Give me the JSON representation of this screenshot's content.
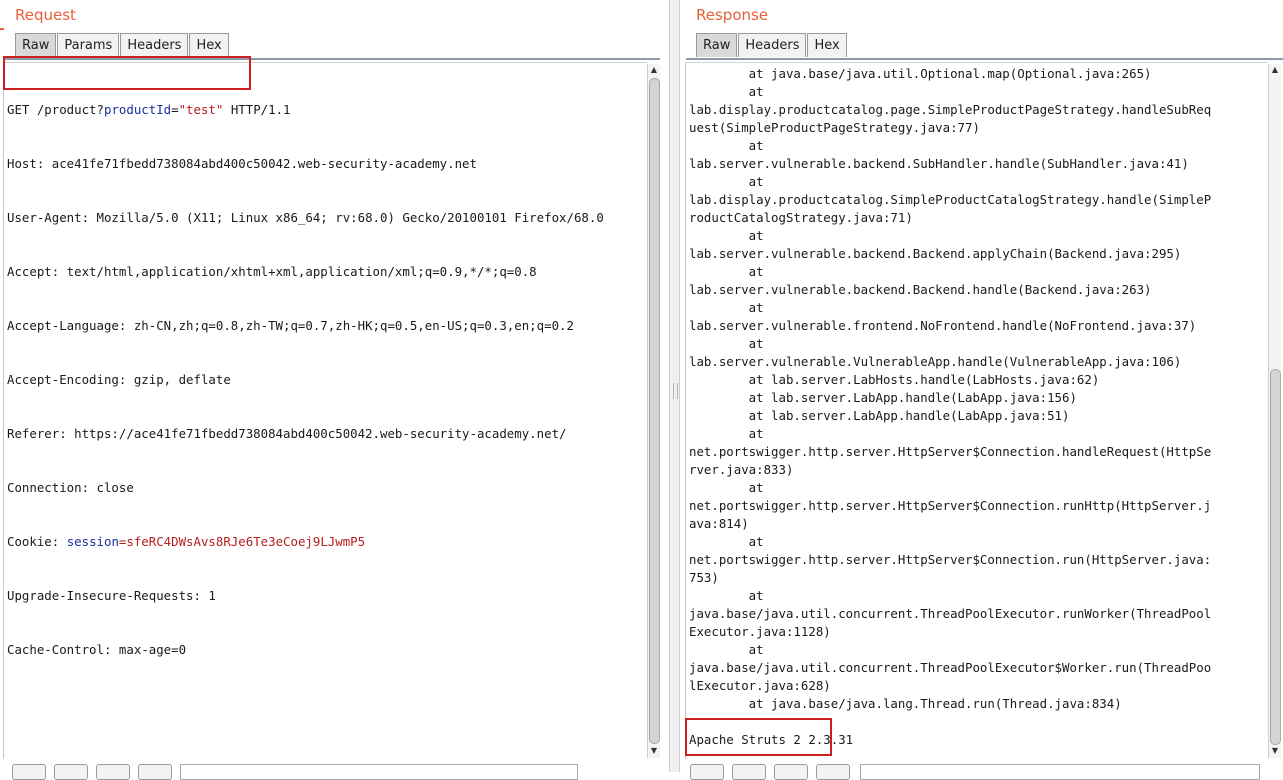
{
  "request": {
    "title": "Request",
    "tabs": [
      {
        "label": "Raw",
        "active": true
      },
      {
        "label": "Params",
        "active": false
      },
      {
        "label": "Headers",
        "active": false
      },
      {
        "label": "Hex",
        "active": false
      }
    ],
    "request_line": {
      "method_path": "GET /product?",
      "param_name": "productId",
      "equals": "=",
      "param_value": "\"test\"",
      "protocol": " HTTP/1.1"
    },
    "headers": [
      "Host: ace41fe71fbedd738084abd400c50042.web-security-academy.net",
      "User-Agent: Mozilla/5.0 (X11; Linux x86_64; rv:68.0) Gecko/20100101 Firefox/68.0",
      "Accept: text/html,application/xhtml+xml,application/xml;q=0.9,*/*;q=0.8",
      "Accept-Language: zh-CN,zh;q=0.8,zh-TW;q=0.7,zh-HK;q=0.5,en-US;q=0.3,en;q=0.2",
      "Accept-Encoding: gzip, deflate",
      "Referer: https://ace41fe71fbedd738084abd400c50042.web-security-academy.net/",
      "Connection: close"
    ],
    "cookie": {
      "prefix": "Cookie: ",
      "name": "session",
      "equals": "=",
      "value": "sfeRC4DWsAvs8RJe6Te3eCoej9LJwmP5"
    },
    "headers_after": [
      "Upgrade-Insecure-Requests: 1",
      "Cache-Control: max-age=0"
    ]
  },
  "response": {
    "title": "Response",
    "tabs": [
      {
        "label": "Raw",
        "active": true
      },
      {
        "label": "Headers",
        "active": false
      },
      {
        "label": "Hex",
        "active": false
      }
    ],
    "body_lines": [
      "        at java.base/java.util.Optional.map(Optional.java:265)",
      "        at",
      "lab.display.productcatalog.page.SimpleProductPageStrategy.handleSubReq",
      "uest(SimpleProductPageStrategy.java:77)",
      "        at",
      "lab.server.vulnerable.backend.SubHandler.handle(SubHandler.java:41)",
      "        at",
      "lab.display.productcatalog.SimpleProductCatalogStrategy.handle(SimpleP",
      "roductCatalogStrategy.java:71)",
      "        at",
      "lab.server.vulnerable.backend.Backend.applyChain(Backend.java:295)",
      "        at",
      "lab.server.vulnerable.backend.Backend.handle(Backend.java:263)",
      "        at",
      "lab.server.vulnerable.frontend.NoFrontend.handle(NoFrontend.java:37)",
      "        at",
      "lab.server.vulnerable.VulnerableApp.handle(VulnerableApp.java:106)",
      "        at lab.server.LabHosts.handle(LabHosts.java:62)",
      "        at lab.server.LabApp.handle(LabApp.java:156)",
      "        at lab.server.LabApp.handle(LabApp.java:51)",
      "        at",
      "net.portswigger.http.server.HttpServer$Connection.handleRequest(HttpSe",
      "rver.java:833)",
      "        at",
      "net.portswigger.http.server.HttpServer$Connection.runHttp(HttpServer.j",
      "ava:814)",
      "        at",
      "net.portswigger.http.server.HttpServer$Connection.run(HttpServer.java:",
      "753)",
      "        at",
      "java.base/java.util.concurrent.ThreadPoolExecutor.runWorker(ThreadPool",
      "Executor.java:1128)",
      "        at",
      "java.base/java.util.concurrent.ThreadPoolExecutor$Worker.run(ThreadPoo",
      "lExecutor.java:628)",
      "        at java.base/java.lang.Thread.run(Thread.java:834)",
      "",
      "Apache Struts 2 2.3.31"
    ]
  }
}
